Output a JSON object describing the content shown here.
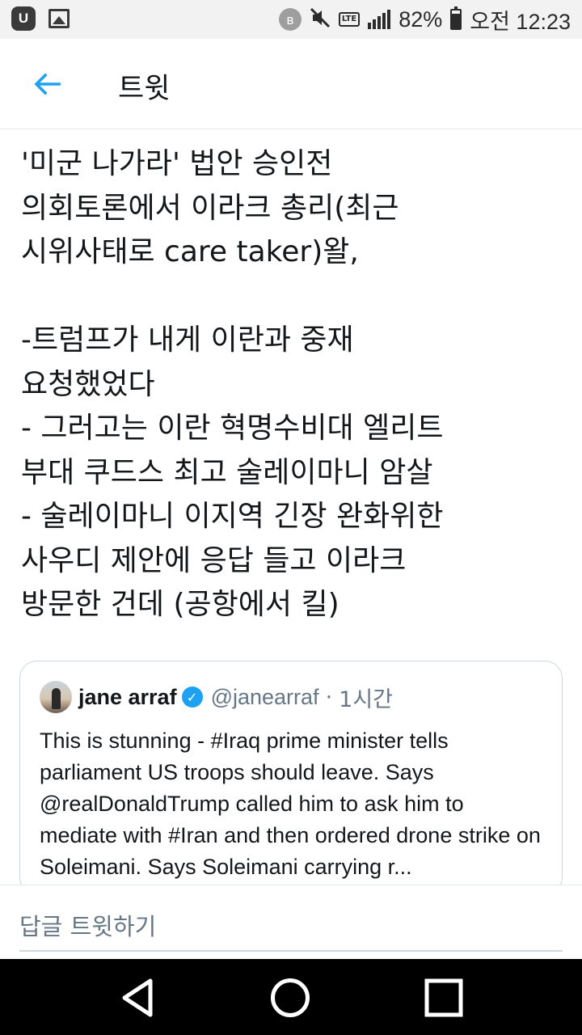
{
  "status_bar": {
    "app_icon": "u-app-icon",
    "app_icon_glyph": "U",
    "bluetooth_glyph": "ʙ",
    "network": "LTE",
    "battery_percent": "82%",
    "battery_level": 0.82,
    "time": "오전 12:23"
  },
  "header": {
    "title": "트윗",
    "accent_color": "#1da1f2"
  },
  "tweet": {
    "text": "'미군 나가라' 법안 승인전\n의회토론에서 이라크 총리(최근\n시위사태로 care taker)왈,\n\n-트럼프가 내게 이란과 중재\n요청했었다\n- 그러고는 이란 혁명수비대 엘리트\n부대 쿠드스 최고 술레이마니 암살\n- 술레이마니 이지역 긴장 완화위한\n사우디 제안에 응답 들고 이라크\n방문한 건데 (공항에서 킬)"
  },
  "quoted_tweet": {
    "name": "jane arraf",
    "verified_glyph": "✓",
    "handle": "@janearraf",
    "separator": "·",
    "time": "1시간",
    "text": "This is stunning - #Iraq prime minister tells parliament US troops should leave. Says @realDonaldTrump called him to ask him to mediate with #Iran and then ordered drone strike on Soleimani. Says Soleimani carrying r..."
  },
  "reply": {
    "placeholder": "답글 트윗하기"
  },
  "nav": {
    "back": "triangle-back-icon",
    "home": "circle-home-icon",
    "recents": "square-recents-icon"
  }
}
